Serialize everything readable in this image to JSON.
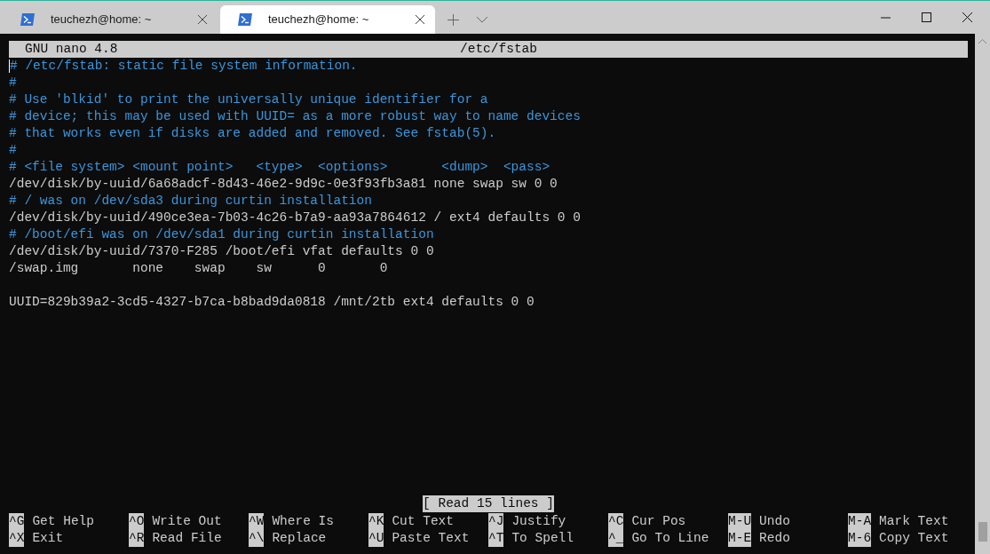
{
  "tabs": [
    {
      "title": "teuchezh@home: ~",
      "selected": false
    },
    {
      "title": "teuchezh@home: ~",
      "selected": true
    }
  ],
  "editor": {
    "title_bar": {
      "app": "GNU nano 4.8",
      "file": "/etc/fstab"
    },
    "lines": [
      {
        "kind": "comment",
        "text": "# /etc/fstab: static file system information."
      },
      {
        "kind": "comment",
        "text": "#"
      },
      {
        "kind": "comment",
        "text": "# Use 'blkid' to print the universally unique identifier for a"
      },
      {
        "kind": "comment",
        "text": "# device; this may be used with UUID= as a more robust way to name devices"
      },
      {
        "kind": "comment",
        "text": "# that works even if disks are added and removed. See fstab(5)."
      },
      {
        "kind": "comment",
        "text": "#"
      },
      {
        "kind": "comment",
        "text": "# <file system> <mount point>   <type>  <options>       <dump>  <pass>"
      },
      {
        "kind": "code",
        "text": "/dev/disk/by-uuid/6a68adcf-8d43-46e2-9d9c-0e3f93fb3a81 none swap sw 0 0"
      },
      {
        "kind": "comment",
        "text": "# / was on /dev/sda3 during curtin installation"
      },
      {
        "kind": "code",
        "text": "/dev/disk/by-uuid/490ce3ea-7b03-4c26-b7a9-aa93a7864612 / ext4 defaults 0 0"
      },
      {
        "kind": "comment",
        "text": "# /boot/efi was on /dev/sda1 during curtin installation"
      },
      {
        "kind": "code",
        "text": "/dev/disk/by-uuid/7370-F285 /boot/efi vfat defaults 0 0"
      },
      {
        "kind": "code",
        "text": "/swap.img       none    swap    sw      0       0"
      },
      {
        "kind": "blank"
      },
      {
        "kind": "code",
        "text": "UUID=829b39a2-3cd5-4327-b7ca-b8bad9da0818 /mnt/2tb ext4 defaults 0 0"
      }
    ],
    "status": "[ Read 15 lines ]",
    "shortcuts": [
      {
        "key": "^G",
        "label": "Get Help"
      },
      {
        "key": "^O",
        "label": "Write Out"
      },
      {
        "key": "^W",
        "label": "Where Is"
      },
      {
        "key": "^K",
        "label": "Cut Text"
      },
      {
        "key": "^J",
        "label": "Justify"
      },
      {
        "key": "^C",
        "label": "Cur Pos"
      },
      {
        "key": "M-U",
        "label": "Undo"
      },
      {
        "key": "M-A",
        "label": "Mark Text"
      },
      {
        "key": "^X",
        "label": "Exit"
      },
      {
        "key": "^R",
        "label": "Read File"
      },
      {
        "key": "^\\",
        "label": "Replace"
      },
      {
        "key": "^U",
        "label": "Paste Text"
      },
      {
        "key": "^T",
        "label": "To Spell"
      },
      {
        "key": "^_",
        "label": "Go To Line"
      },
      {
        "key": "M-E",
        "label": "Redo"
      },
      {
        "key": "M-6",
        "label": "Copy Text"
      }
    ]
  }
}
